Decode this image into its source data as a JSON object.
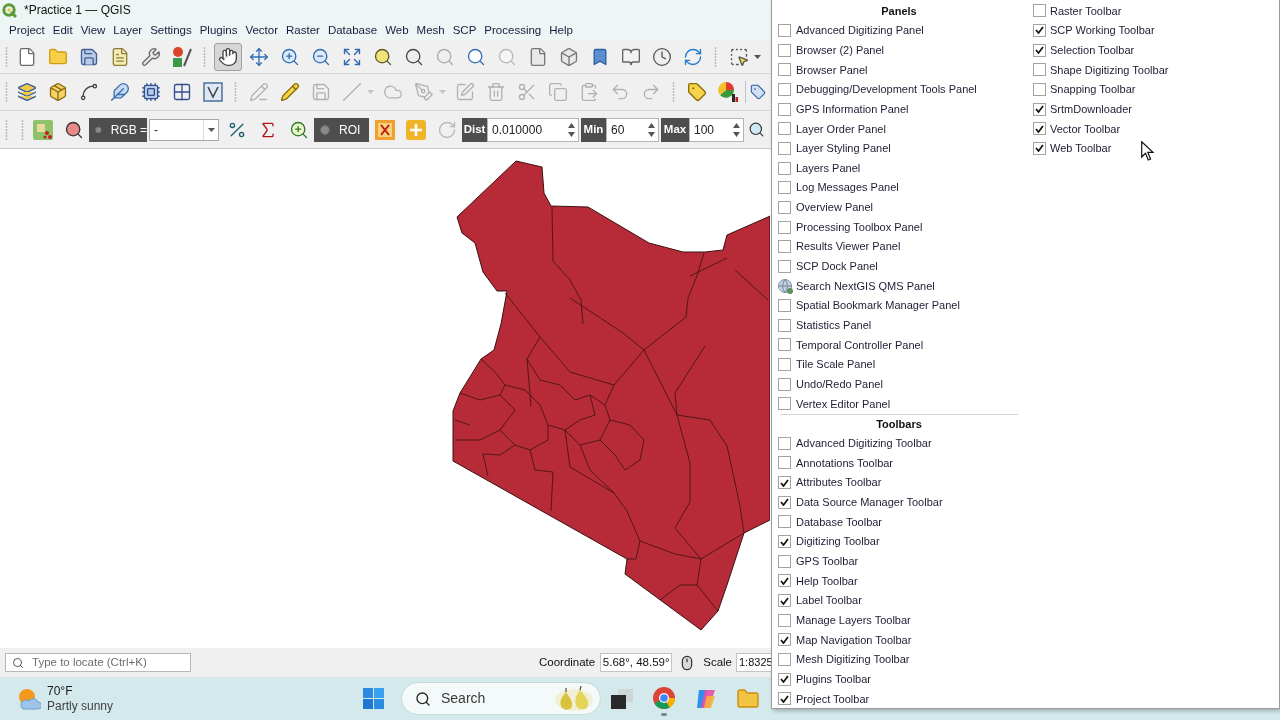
{
  "window": {
    "title": "*Practice 1 — QGIS"
  },
  "menu_bar": [
    "Project",
    "Edit",
    "View",
    "Layer",
    "Settings",
    "Plugins",
    "Vector",
    "Raster",
    "Database",
    "Web",
    "Mesh",
    "SCP",
    "Processing",
    "Help"
  ],
  "toolbars": [
    {
      "items": [
        {
          "disabled": false,
          "selected": false
        },
        {
          "disabled": false,
          "selected": false
        },
        {
          "disabled": false,
          "selected": false
        },
        {
          "disabled": false,
          "selected": false
        },
        {
          "disabled": false,
          "selected": false
        },
        {
          "disabled": false,
          "selected": false
        },
        {
          "disabled": false,
          "selected": true
        },
        {
          "disabled": false,
          "selected": false
        },
        {
          "disabled": false,
          "selected": false
        },
        {
          "disabled": false,
          "selected": false
        },
        {
          "disabled": false,
          "selected": false
        },
        {
          "disabled": false,
          "selected": false
        },
        {
          "disabled": false,
          "selected": false
        },
        {
          "disabled": true,
          "selected": false
        },
        {
          "disabled": false,
          "selected": false
        },
        {
          "disabled": true,
          "selected": false
        },
        {
          "disabled": false,
          "selected": false
        },
        {
          "disabled": false,
          "selected": false
        },
        {
          "disabled": false,
          "selected": false
        },
        {
          "disabled": false,
          "selected": false
        },
        {
          "disabled": false,
          "selected": false
        },
        {
          "disabled": false,
          "selected": false
        },
        {
          "disabled": false,
          "selected": false
        }
      ]
    },
    {
      "items": [
        {
          "disabled": false
        },
        {
          "disabled": false
        },
        {
          "disabled": false
        },
        {
          "disabled": false
        },
        {
          "disabled": false
        },
        {
          "disabled": false
        },
        {
          "disabled": false
        },
        {
          "disabled": true
        },
        {
          "disabled": false
        },
        {
          "disabled": true
        },
        {
          "disabled": true
        },
        {
          "disabled": true
        },
        {
          "disabled": true
        },
        {
          "disabled": true
        },
        {
          "disabled": true
        },
        {
          "disabled": true
        },
        {
          "disabled": true
        },
        {
          "disabled": true
        },
        {
          "disabled": true
        },
        {
          "disabled": true
        },
        {
          "disabled": false
        },
        {
          "disabled": false
        },
        {
          "disabled": false
        }
      ]
    }
  ],
  "scp_toolbar": {
    "icons": [
      {
        "disabled": false
      },
      {
        "disabled": false
      },
      {
        "disabled": false
      },
      {
        "disabled": false
      },
      {
        "disabled": false
      },
      {
        "disabled": false
      },
      {
        "disabled": false
      },
      {
        "disabled": true
      },
      {
        "disabled": false
      }
    ],
    "rgb": {
      "label": "RGB =",
      "checked": false,
      "value": "-"
    },
    "roi": {
      "label": "ROI",
      "checked": false
    },
    "dist": {
      "label": "Dist",
      "value": "0.010000"
    },
    "min": {
      "label": "Min",
      "value": "60"
    },
    "max": {
      "label": "Max",
      "value": "100"
    }
  },
  "status_bar": {
    "locator": {
      "placeholder": "Type to locate (Ctrl+K)"
    },
    "coordinate": {
      "label": "Coordinate",
      "value": "5.68°, 48.59°"
    },
    "scale": {
      "label": "Scale",
      "value": "1:8325"
    }
  },
  "taskbar": {
    "weather": {
      "temperature": "70°F",
      "condition": "Partly sunny"
    },
    "search": {
      "placeholder": "Search"
    }
  },
  "view_menu": {
    "sections": [
      {
        "title": "Panels",
        "items": [
          {
            "label": "Advanced Digitizing Panel",
            "kind": "checkbox",
            "checked": false
          },
          {
            "label": "Browser (2) Panel",
            "kind": "checkbox",
            "checked": false
          },
          {
            "label": "Browser Panel",
            "kind": "checkbox",
            "checked": false
          },
          {
            "label": "Debugging/Development Tools Panel",
            "kind": "checkbox",
            "checked": false
          },
          {
            "label": "GPS Information Panel",
            "kind": "checkbox",
            "checked": false
          },
          {
            "label": "Layer Order Panel",
            "kind": "checkbox",
            "checked": false
          },
          {
            "label": "Layer Styling Panel",
            "kind": "checkbox",
            "checked": false
          },
          {
            "label": "Layers Panel",
            "kind": "checkbox",
            "checked": false
          },
          {
            "label": "Log Messages Panel",
            "kind": "checkbox",
            "checked": false
          },
          {
            "label": "Overview Panel",
            "kind": "checkbox",
            "checked": false
          },
          {
            "label": "Processing Toolbox Panel",
            "kind": "checkbox",
            "checked": false
          },
          {
            "label": "Results Viewer Panel",
            "kind": "checkbox",
            "checked": false
          },
          {
            "label": "SCP Dock Panel",
            "kind": "checkbox",
            "checked": false
          },
          {
            "label": "Search NextGIS QMS Panel",
            "kind": "icon"
          },
          {
            "label": "Spatial Bookmark Manager Panel",
            "kind": "checkbox",
            "checked": false
          },
          {
            "label": "Statistics Panel",
            "kind": "checkbox",
            "checked": false
          },
          {
            "label": "Temporal Controller Panel",
            "kind": "checkbox",
            "checked": false
          },
          {
            "label": "Tile Scale Panel",
            "kind": "checkbox",
            "checked": false
          },
          {
            "label": "Undo/Redo Panel",
            "kind": "checkbox",
            "checked": false
          },
          {
            "label": "Vertex Editor Panel",
            "kind": "checkbox",
            "checked": false
          }
        ]
      },
      {
        "title": "Toolbars",
        "items": [
          {
            "label": "Advanced Digitizing Toolbar",
            "checked": false
          },
          {
            "label": "Annotations Toolbar",
            "checked": false
          },
          {
            "label": "Attributes Toolbar",
            "checked": true
          },
          {
            "label": "Data Source Manager Toolbar",
            "checked": true
          },
          {
            "label": "Database Toolbar",
            "checked": false
          },
          {
            "label": "Digitizing Toolbar",
            "checked": true
          },
          {
            "label": "GPS Toolbar",
            "checked": false
          },
          {
            "label": "Help Toolbar",
            "checked": true
          },
          {
            "label": "Label Toolbar",
            "checked": true
          },
          {
            "label": "Manage Layers Toolbar",
            "checked": false
          },
          {
            "label": "Map Navigation Toolbar",
            "checked": true
          },
          {
            "label": "Mesh Digitizing Toolbar",
            "checked": false
          },
          {
            "label": "Plugins Toolbar",
            "checked": true
          },
          {
            "label": "Project Toolbar",
            "checked": true
          },
          {
            "label": "Raster Toolbar",
            "checked": false
          },
          {
            "label": "SCP Working Toolbar",
            "checked": true
          },
          {
            "label": "Selection Toolbar",
            "checked": true
          },
          {
            "label": "Shape Digitizing Toolbar",
            "checked": false
          },
          {
            "label": "Snapping Toolbar",
            "checked": false
          },
          {
            "label": "SrtmDownloader",
            "checked": true
          },
          {
            "label": "Vector Toolbar",
            "checked": true
          },
          {
            "label": "Web Toolbar",
            "checked": true
          }
        ]
      }
    ]
  }
}
